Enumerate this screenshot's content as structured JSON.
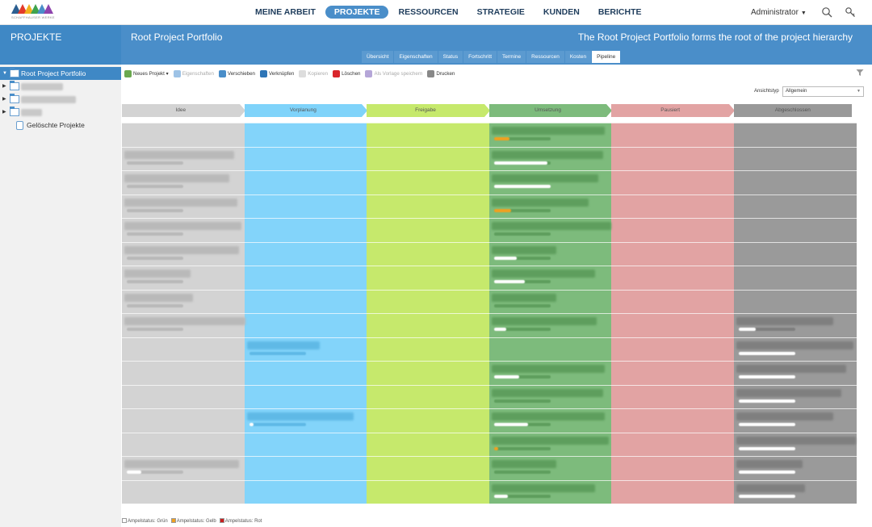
{
  "nav": {
    "logo_text": "SCHAFFHAUSER WERKE",
    "items": [
      "MEINE ARBEIT",
      "PROJEKTE",
      "RESSOURCEN",
      "STRATEGIE",
      "KUNDEN",
      "BERICHTE"
    ],
    "active": "PROJEKTE",
    "user": "Administrator"
  },
  "sidebar": {
    "header": "PROJEKTE",
    "tree": [
      {
        "label": "Root Project Portfolio",
        "selected": true
      },
      {
        "label": "",
        "blur_width": 52
      },
      {
        "label": "",
        "blur_width": 68
      },
      {
        "label": "",
        "blur_width": 26
      },
      {
        "label": "Gelöschte Projekte"
      }
    ]
  },
  "header": {
    "title": "Root Project Portfolio",
    "description": "The Root Project Portfolio forms the root of the project hierarchy",
    "tabs": [
      "Übersicht",
      "Eigenschaften",
      "Status",
      "Fortschritt",
      "Termine",
      "Ressourcen",
      "Kosten",
      "Pipeline"
    ],
    "active_tab": "Pipeline"
  },
  "toolbar": [
    {
      "label": "Neues Projekt ▾",
      "icon": "new-project-icon",
      "color": "#6aa84f",
      "enabled": true
    },
    {
      "label": "Eigenschaften",
      "icon": "info-icon",
      "color": "#9ec3e6",
      "enabled": false
    },
    {
      "label": "Verschieben",
      "icon": "move-icon",
      "color": "#4a8ec9",
      "enabled": true
    },
    {
      "label": "Verknüpfen",
      "icon": "link-icon",
      "color": "#2e75b6",
      "enabled": true
    },
    {
      "label": "Kopieren",
      "icon": "copy-icon",
      "color": "#dddddd",
      "enabled": false
    },
    {
      "label": "Löschen",
      "icon": "delete-icon",
      "color": "#d9262c",
      "enabled": true
    },
    {
      "label": "Als Vorlage speichern",
      "icon": "save-template-icon",
      "color": "#b5a6d8",
      "enabled": false
    },
    {
      "label": "Drucken",
      "icon": "print-icon",
      "color": "#888888",
      "enabled": true
    }
  ],
  "view": {
    "label": "Ansichtstyp",
    "selected": "Allgemein"
  },
  "stages": [
    {
      "label": "Idee",
      "color": "#d3d3d3"
    },
    {
      "label": "Vorplanung",
      "color": "#7fd3fa"
    },
    {
      "label": "Freigabe",
      "color": "#c6e96c"
    },
    {
      "label": "Umsetzung",
      "color": "#7dbb7c"
    },
    {
      "label": "Pausiert",
      "color": "#e2a3a3"
    },
    {
      "label": "Abgeschlossen",
      "color": "#999999"
    }
  ],
  "board": {
    "column_colors": [
      "#d3d3d3",
      "#83d4fa",
      "#c6e96c",
      "#7dbb7c",
      "#e2a3a3",
      "#9a9a9a"
    ],
    "cards": [
      {
        "stage": 3,
        "progress": 0.28,
        "status": "yellow"
      },
      {
        "stage": 0,
        "progress": 0.0,
        "status": "none"
      },
      {
        "stage": 3,
        "progress": 0.95,
        "status": "green"
      },
      {
        "stage": 0,
        "progress": 0.0,
        "status": "none"
      },
      {
        "stage": 3,
        "progress": 1.0,
        "status": "green"
      },
      {
        "stage": 0,
        "progress": 0.0,
        "status": "none"
      },
      {
        "stage": 3,
        "progress": 0.3,
        "status": "yellow"
      },
      {
        "stage": 0,
        "progress": 0.0,
        "status": "none"
      },
      {
        "stage": 3,
        "progress": 0.0,
        "status": "none"
      },
      {
        "stage": 0,
        "progress": 0.0,
        "status": "none"
      },
      {
        "stage": 3,
        "progress": 0.4,
        "status": "green"
      },
      {
        "stage": 0,
        "progress": 0.0,
        "status": "none"
      },
      {
        "stage": 3,
        "progress": 0.55,
        "status": "green"
      },
      {
        "stage": 0,
        "progress": 0.0,
        "status": "none"
      },
      {
        "stage": 3,
        "progress": 0.0,
        "status": "none"
      },
      {
        "stage": 0,
        "progress": 0.0,
        "status": "none"
      },
      {
        "stage": 3,
        "progress": 0.22,
        "status": "green"
      },
      {
        "stage": 5,
        "progress": 0.3,
        "status": "green"
      },
      {
        "stage": 1,
        "progress": 0.0,
        "status": "none"
      },
      {
        "stage": 5,
        "progress": 1.0,
        "status": "green"
      },
      {
        "stage": 3,
        "progress": 0.45,
        "status": "green"
      },
      {
        "stage": 5,
        "progress": 1.0,
        "status": "green"
      },
      {
        "stage": 3,
        "progress": 0.0,
        "status": "none"
      },
      {
        "stage": 5,
        "progress": 1.0,
        "status": "green"
      },
      {
        "stage": 1,
        "progress": 0.08,
        "status": "green"
      },
      {
        "stage": 3,
        "progress": 0.6,
        "status": "green"
      },
      {
        "stage": 5,
        "progress": 1.0,
        "status": "green"
      },
      {
        "stage": 3,
        "progress": 0.08,
        "status": "yellow"
      },
      {
        "stage": 5,
        "progress": 1.0,
        "status": "green"
      },
      {
        "stage": 0,
        "progress": 0.25,
        "status": "green"
      },
      {
        "stage": 3,
        "progress": 0.0,
        "status": "none"
      },
      {
        "stage": 5,
        "progress": 1.0,
        "status": "green"
      },
      {
        "stage": 3,
        "progress": 0.25,
        "status": "green"
      },
      {
        "stage": 5,
        "progress": 1.0,
        "status": "green"
      }
    ]
  },
  "legend": [
    {
      "label": "Ampelstatus: Grün",
      "color": "#ffffff"
    },
    {
      "label": "Ampelstatus: Gelb",
      "color": "#f0a020"
    },
    {
      "label": "Ampelstatus: Rot",
      "color": "#c81e1e"
    }
  ]
}
